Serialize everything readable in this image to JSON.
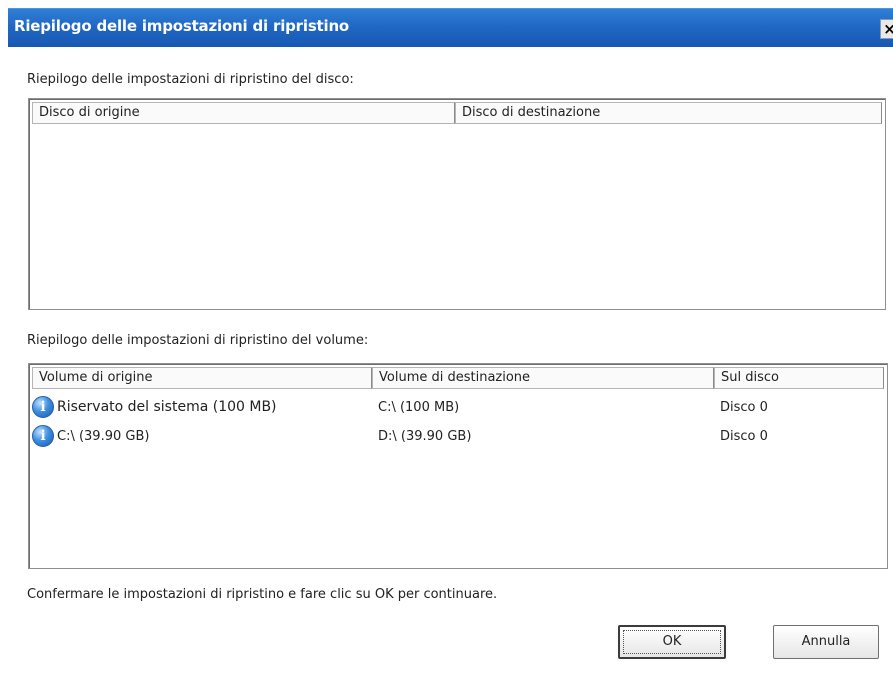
{
  "dialog": {
    "title": "Riepilogo delle impostazioni di ripristino",
    "close_glyph": "×"
  },
  "disk_section": {
    "label": "Riepilogo delle impostazioni di ripristino del disco:",
    "columns": [
      "Disco di origine",
      "Disco di destinazione"
    ],
    "rows": []
  },
  "volume_section": {
    "label": "Riepilogo delle impostazioni di ripristino del volume:",
    "columns": [
      "Volume di origine",
      "Volume di destinazione",
      "Sul disco"
    ],
    "rows": [
      {
        "icon": "info-icon",
        "source": "Riservato del sistema (100 MB)",
        "destination": "C:\\ (100 MB)",
        "disk": "Disco 0"
      },
      {
        "icon": "info-icon",
        "source": "C:\\ (39.90 GB)",
        "destination": "D:\\ (39.90 GB)",
        "disk": "Disco 0"
      }
    ]
  },
  "footer": {
    "message": "Confermare le impostazioni di ripristino e fare clic su OK per continuare.",
    "ok_label": "OK",
    "cancel_label": "Annulla"
  },
  "colors": {
    "titlebar": "#1f66c2",
    "window_bg": "#ffffff"
  }
}
